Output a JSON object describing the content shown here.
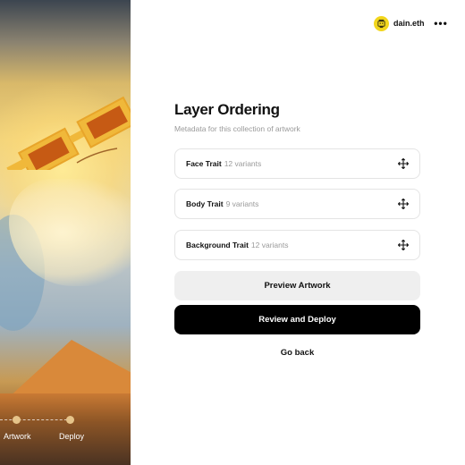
{
  "header": {
    "username": "dain.eth",
    "avatar_icon": "robot-avatar-icon",
    "menu_icon": "more-horizontal-icon",
    "menu_glyph": "•••"
  },
  "stepper": {
    "steps": [
      {
        "label": "Artwork"
      },
      {
        "label": "Deploy"
      }
    ]
  },
  "main": {
    "title": "Layer Ordering",
    "subtitle": "Metadata for this collection of artwork",
    "traits": [
      {
        "name": "Face Trait",
        "count": "12 variants"
      },
      {
        "name": "Body Trait",
        "count": "9 variants"
      },
      {
        "name": "Background Trait",
        "count": "12 variants"
      }
    ],
    "buttons": {
      "preview": "Preview Artwork",
      "deploy": "Review and Deploy",
      "back": "Go back"
    }
  },
  "colors": {
    "accent_dark": "#000000",
    "secondary_button": "#efefef",
    "avatar_bg": "#f2d61c"
  }
}
